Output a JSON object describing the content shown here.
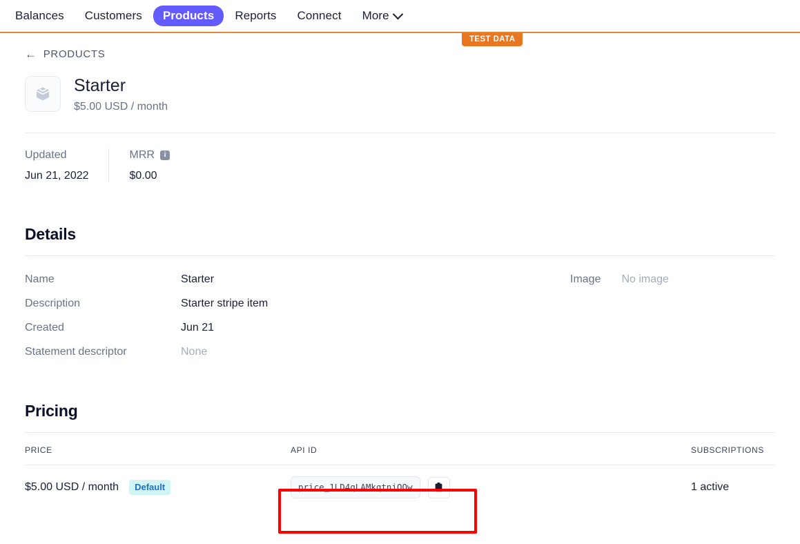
{
  "nav": {
    "items": [
      {
        "label": "Balances",
        "active": false
      },
      {
        "label": "Customers",
        "active": false
      },
      {
        "label": "Products",
        "active": true
      },
      {
        "label": "Reports",
        "active": false
      },
      {
        "label": "Connect",
        "active": false
      },
      {
        "label": "More",
        "active": false,
        "chevron": "chevron-down-icon"
      }
    ],
    "test_badge": "TEST DATA",
    "accent_color": "#635bff",
    "test_badge_color": "#e87722"
  },
  "breadcrumb": {
    "arrow": "←",
    "label": "PRODUCTS"
  },
  "product": {
    "icon": "box-icon",
    "name": "Starter",
    "price_summary": "$5.00 USD / month"
  },
  "metrics": [
    {
      "label": "Updated",
      "value": "Jun 21, 2022",
      "info": false
    },
    {
      "label": "MRR",
      "value": "$0.00",
      "info": true,
      "info_icon": "info-icon"
    }
  ],
  "details": {
    "title": "Details",
    "rows": [
      {
        "label": "Name",
        "value": "Starter",
        "muted": false
      },
      {
        "label": "Description",
        "value": "Starter stripe item",
        "muted": false
      },
      {
        "label": "Created",
        "value": "Jun 21",
        "muted": false
      },
      {
        "label": "Statement descriptor",
        "value": "None",
        "muted": true
      }
    ],
    "image_label": "Image",
    "image_value": "No image"
  },
  "pricing": {
    "title": "Pricing",
    "columns": [
      "PRICE",
      "API ID",
      "SUBSCRIPTIONS"
    ],
    "rows": [
      {
        "price": "$5.00 USD / month",
        "badge": "Default",
        "api_id": "price_1LD4qLAMkqtniQQw",
        "copy_icon": "clipboard-icon",
        "subscriptions": "1 active"
      }
    ]
  },
  "annotation": {
    "highlight_color": "#ff0000"
  }
}
